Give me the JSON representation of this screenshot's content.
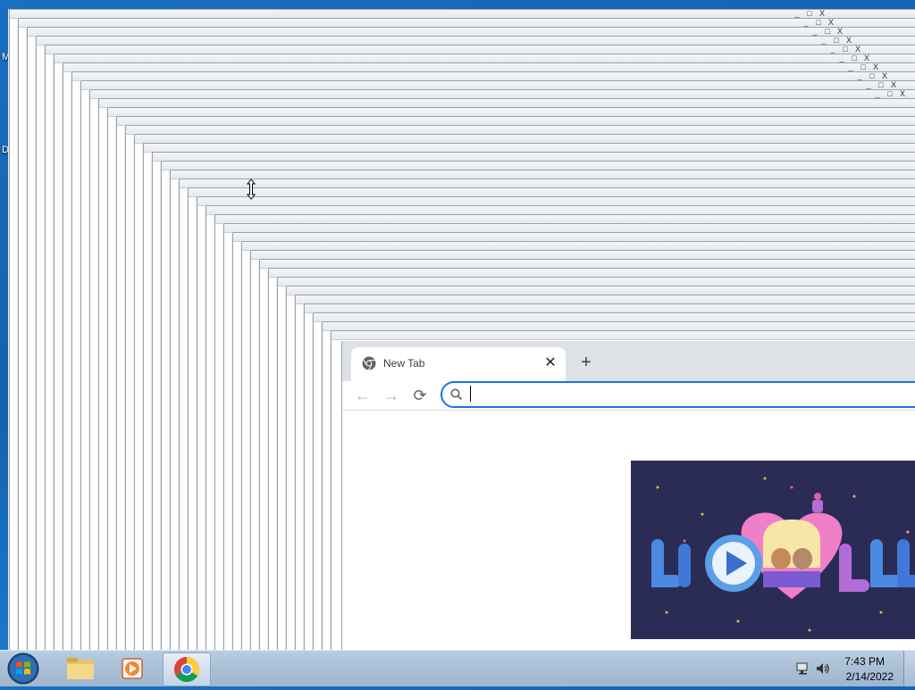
{
  "desktop": {
    "icon_labels": [
      "M",
      "D"
    ]
  },
  "ghost_window": {
    "controls": [
      "_",
      "□",
      "X"
    ]
  },
  "browser": {
    "tab": {
      "title": "New Tab",
      "close_label": "✕",
      "favicon": "chrome-icon"
    },
    "new_tab_label": "+",
    "nav": {
      "back_label": "←",
      "forward_label": "→",
      "reload_label": "⟳"
    },
    "omnibox": {
      "value": "",
      "placeholder": ""
    },
    "doodle": {
      "description_icon": "google-valentines-doodle",
      "play_icon": "play-icon"
    }
  },
  "taskbar": {
    "start_icon": "windows-orb-icon",
    "pinned": [
      {
        "name": "file-explorer-icon"
      },
      {
        "name": "media-player-icon"
      },
      {
        "name": "chrome-icon",
        "active": true
      }
    ],
    "tray": {
      "time": "7:43 PM",
      "date": "2/14/2022",
      "icons": [
        "network-icon",
        "volume-icon"
      ]
    }
  },
  "colors": {
    "accent": "#1a73e8",
    "desktop": "#1a6fc0",
    "taskbar": "#a9bfd6",
    "doodle_bg": "#2b2c55",
    "heart": "#f07fc8"
  }
}
